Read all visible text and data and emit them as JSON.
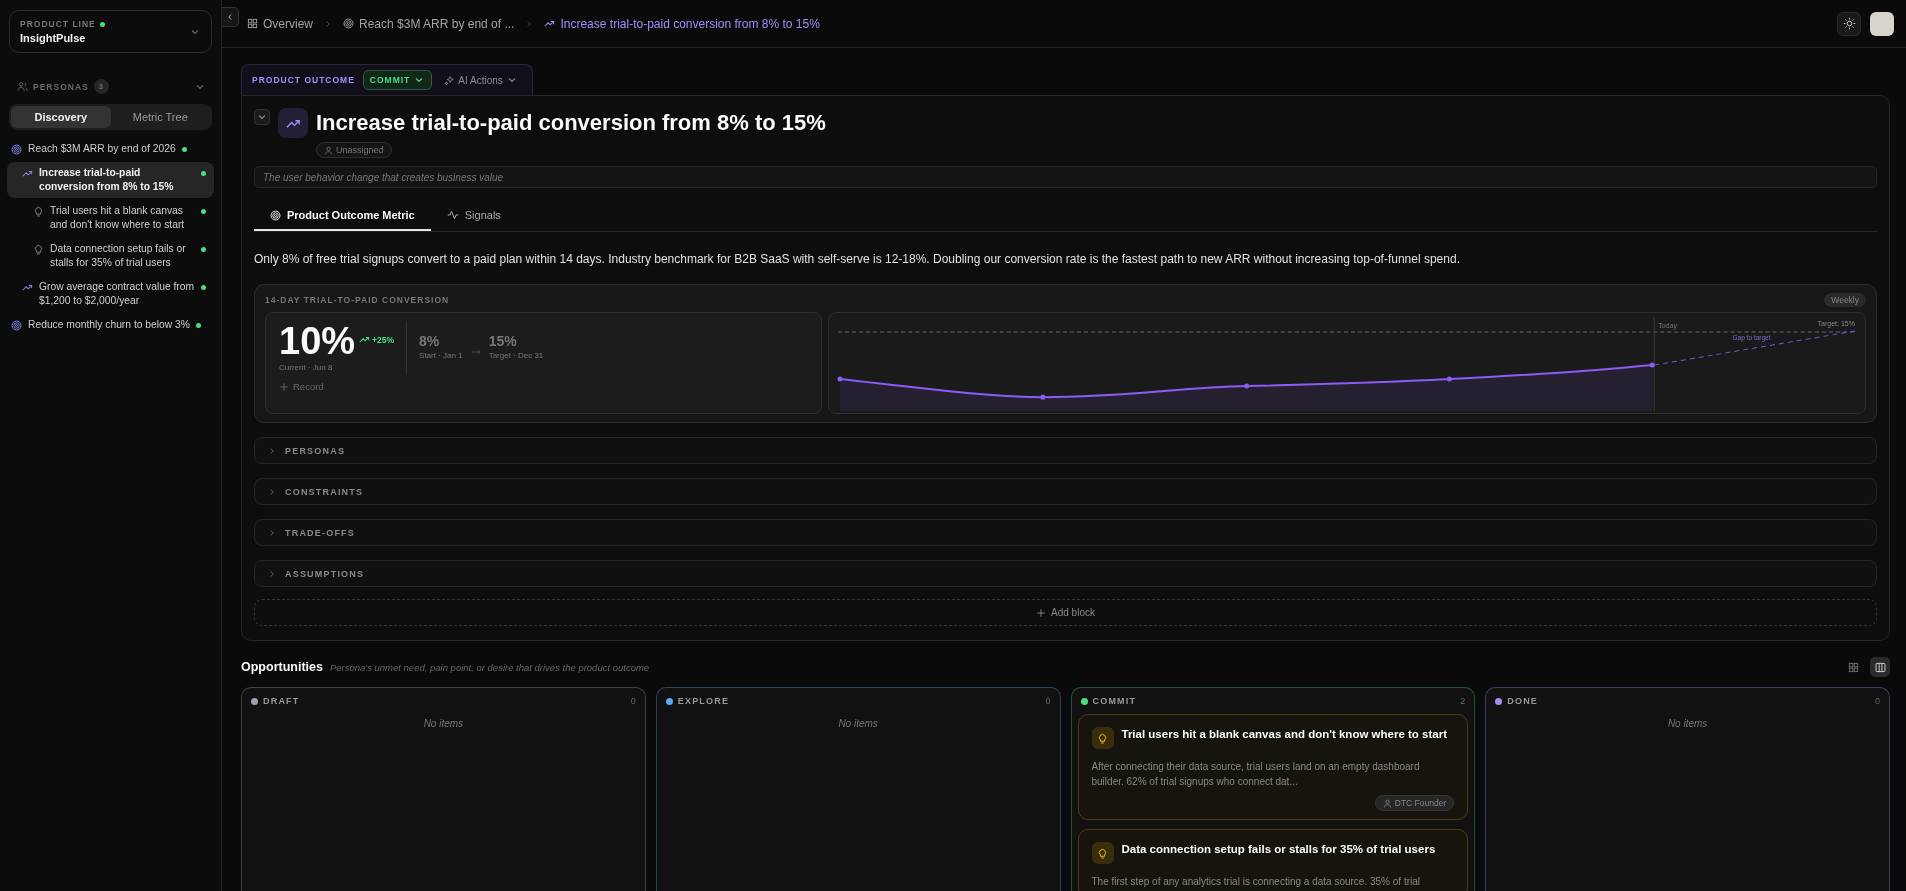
{
  "sidebar": {
    "product_line": {
      "label": "PRODUCT LINE",
      "value": "InsightPulse"
    },
    "personas": {
      "label": "PERSONAS",
      "count": "3"
    },
    "view_tabs": [
      {
        "label": "Discovery",
        "selected": true
      },
      {
        "label": "Metric Tree",
        "selected": false
      }
    ],
    "tree": [
      {
        "kind": "goal",
        "label": "Reach $3M ARR by end of 2026",
        "selected": false,
        "children": [
          {
            "kind": "outcome",
            "label": "Increase trial-to-paid conversion from 8% to 15%",
            "selected": true,
            "children": [
              {
                "kind": "opportunity",
                "label": "Trial users hit a blank canvas and don't know where to start",
                "selected": false
              },
              {
                "kind": "opportunity",
                "label": "Data connection setup fails or stalls for 35% of trial users",
                "selected": false
              }
            ]
          },
          {
            "kind": "outcome",
            "label": "Grow average contract value from $1,200 to $2,000/year",
            "selected": false
          }
        ]
      },
      {
        "kind": "goal",
        "label": "Reduce monthly churn to below 3%",
        "selected": false
      }
    ]
  },
  "breadcrumbs": [
    {
      "kind": "overview",
      "label": "Overview",
      "selected": false
    },
    {
      "kind": "goal",
      "label": "Reach $3M ARR by end of ...",
      "selected": false
    },
    {
      "kind": "outcome",
      "label": "Increase trial-to-paid conversion from 8% to 15%",
      "selected": true
    }
  ],
  "outcome": {
    "type_label": "PRODUCT OUTCOME",
    "status": "COMMIT",
    "ai_actions": "AI Actions",
    "title": "Increase trial-to-paid conversion from 8% to 15%",
    "assignee": "Unassigned",
    "description_placeholder": "The user behavior change that creates business value",
    "tabs": [
      {
        "kind": "metric",
        "label": "Product Outcome Metric",
        "selected": true
      },
      {
        "kind": "signals",
        "label": "Signals",
        "selected": false
      }
    ],
    "summary": "Only 8% of free trial signups convert to a paid plan within 14 days. Industry benchmark for B2B SaaS with self-serve is 12-18%. Doubling our conversion rate is the fastest path to new ARR without increasing top-of-funnel spend.",
    "metric": {
      "name": "14-DAY TRIAL-TO-PAID CONVERSION",
      "period": "Weekly",
      "current": "10%",
      "change": "+25%",
      "current_caption": "Current · Jun 8",
      "start": "8%",
      "start_caption": "Start · Jan 1",
      "target": "15%",
      "target_caption": "Target · Dec 31",
      "record": "Record",
      "chart": {
        "today_label": "Today",
        "target_label": "Target: 15%",
        "gap_label": "Gap to target"
      }
    },
    "blocks": [
      {
        "label": "PERSONAS",
        "expanded": false
      },
      {
        "label": "CONSTRAINTS",
        "expanded": false
      },
      {
        "label": "TRADE-OFFS",
        "expanded": false
      },
      {
        "label": "ASSUMPTIONS",
        "expanded": false
      }
    ],
    "add_block": "Add block"
  },
  "opportunities": {
    "title": "Opportunities",
    "subtitle": "Persona's unmet need, pain point, or desire that drives the product outcome",
    "view_modes": [
      {
        "kind": "grid",
        "selected": false
      },
      {
        "kind": "board",
        "selected": true
      }
    ],
    "columns": [
      {
        "name": "DRAFT",
        "color": "#9ca3af",
        "count": "0",
        "empty_text": "No items"
      },
      {
        "name": "EXPLORE",
        "color": "#60a5fa",
        "count": "0",
        "empty_text": "No items"
      },
      {
        "name": "COMMIT",
        "color": "#4ade80",
        "count": "2",
        "cards": [
          {
            "title": "Trial users hit a blank canvas and don't know where to start",
            "body": "After connecting their data source, trial users land on an empty dashboard builder. 62% of trial signups who connect dat...",
            "persona": "DTC Founder"
          },
          {
            "title": "Data connection setup fails or stalls for 35% of trial users",
            "body": "The first step of any analytics trial is connecting a data source. 35% of trial"
          }
        ]
      },
      {
        "name": "DONE",
        "color": "#a78bfa",
        "count": "0",
        "empty_text": "No items"
      }
    ]
  }
}
